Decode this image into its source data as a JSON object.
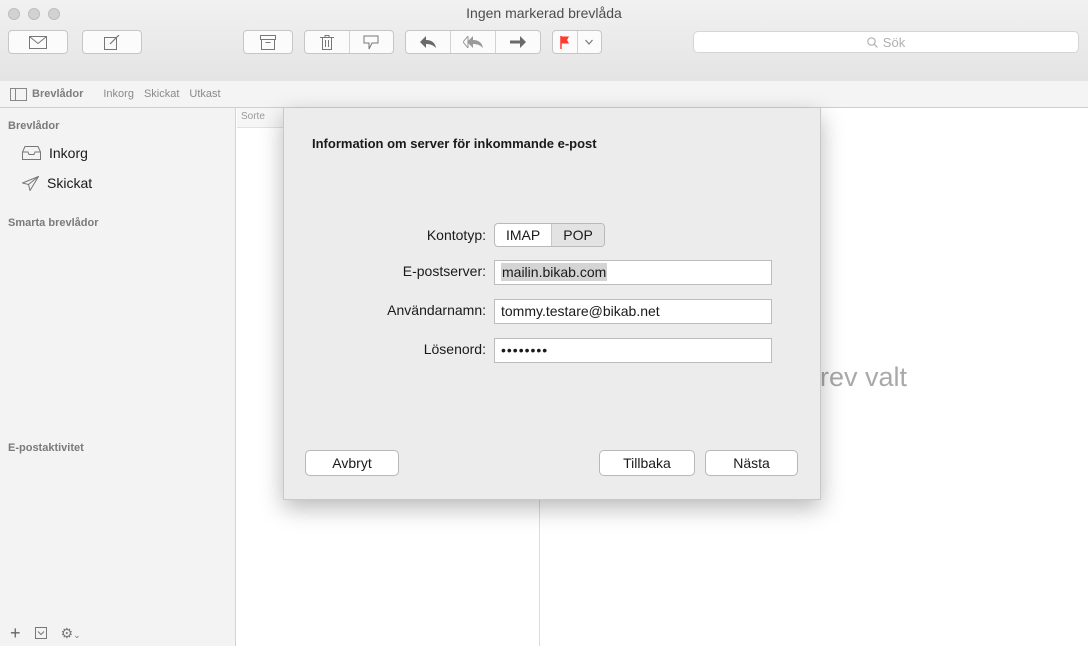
{
  "window": {
    "title": "Ingen markerad brevlåda"
  },
  "toolbar": {
    "icons": [
      "get-mail-icon",
      "compose-icon",
      "archive-icon",
      "trash-icon",
      "junk-icon",
      "reply-icon",
      "reply-all-icon",
      "forward-icon",
      "flag-icon",
      "chevron-down-icon"
    ],
    "flag_color": "#ff3b30",
    "search_placeholder": "Sök"
  },
  "favorites": {
    "mailboxes_label": "Brevlådor",
    "items": [
      "Inkorg",
      "Skickat",
      "Utkast"
    ]
  },
  "sidebar": {
    "section_mailboxes": "Brevlådor",
    "items": [
      {
        "label": "Inkorg",
        "icon": "inbox-icon"
      },
      {
        "label": "Skickat",
        "icon": "sent-icon"
      }
    ],
    "section_smart": "Smarta brevlådor",
    "section_activity": "E-postaktivitet",
    "footer_icons": [
      "plus-icon",
      "mailbox-icon",
      "gear-icon"
    ]
  },
  "message_list": {
    "sort_label": "Sorte"
  },
  "viewer": {
    "empty_text": "rev valt"
  },
  "dialog": {
    "title": "Information om server för inkommande e-post",
    "account_type_label": "Kontotyp:",
    "account_type_options": [
      "IMAP",
      "POP"
    ],
    "account_type_selected": "POP",
    "server_label": "E-postserver:",
    "server_value": "mailin.bikab.com",
    "username_label": "Användarnamn:",
    "username_value": "tommy.testare@bikab.net",
    "password_label": "Lösenord:",
    "password_value": "••••••••",
    "cancel_label": "Avbryt",
    "back_label": "Tillbaka",
    "next_label": "Nästa"
  }
}
